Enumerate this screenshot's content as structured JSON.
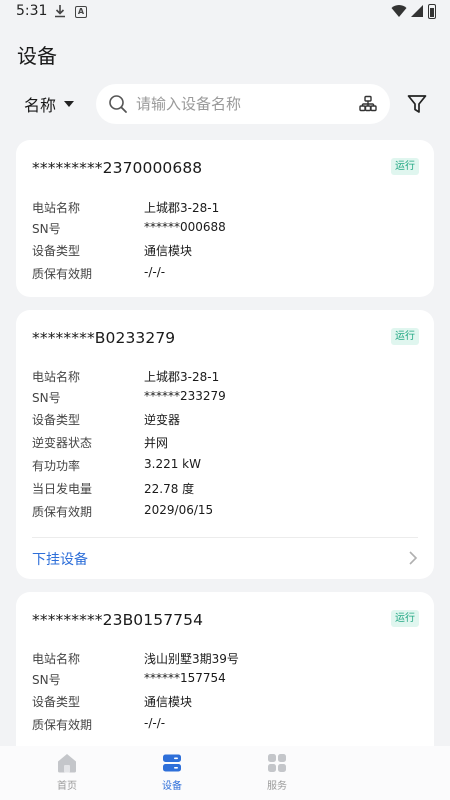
{
  "status_bar": {
    "time": "5:31",
    "icons": [
      "download-icon",
      "a-notification-icon",
      "wifi-icon",
      "signal-icon",
      "battery-icon"
    ]
  },
  "header": {
    "title": "设备"
  },
  "search": {
    "sort_label": "名称",
    "placeholder": "请输入设备名称"
  },
  "colors": {
    "accent": "#2e6fd9",
    "badge_bg": "#e0f6ef",
    "badge_text": "#21a783"
  },
  "devices": [
    {
      "id": "*********2370000688",
      "status": "运行",
      "fields": [
        {
          "label": "电站名称",
          "value": "上城郡3-28-1"
        },
        {
          "label": "SN号",
          "value": "******000688"
        },
        {
          "label": "设备类型",
          "value": "通信模块"
        },
        {
          "label": "质保有效期",
          "value": "-/-/-"
        }
      ]
    },
    {
      "id": "********B0233279",
      "status": "运行",
      "fields": [
        {
          "label": "电站名称",
          "value": "上城郡3-28-1"
        },
        {
          "label": "SN号",
          "value": "******233279"
        },
        {
          "label": "设备类型",
          "value": "逆变器"
        },
        {
          "label": "逆变器状态",
          "value": "并网"
        },
        {
          "label": "有功功率",
          "value": "3.221 kW"
        },
        {
          "label": "当日发电量",
          "value": "22.78 度"
        },
        {
          "label": "质保有效期",
          "value": "2029/06/15"
        }
      ],
      "sub_link": "下挂设备"
    },
    {
      "id": "*********23B0157754",
      "status": "运行",
      "fields": [
        {
          "label": "电站名称",
          "value": "浅山别墅3期39号"
        },
        {
          "label": "SN号",
          "value": "******157754"
        },
        {
          "label": "设备类型",
          "value": "通信模块"
        },
        {
          "label": "质保有效期",
          "value": "-/-/-"
        }
      ]
    }
  ],
  "bottom_nav": [
    {
      "label": "首页",
      "icon": "home-icon",
      "active": false
    },
    {
      "label": "设备",
      "icon": "device-icon",
      "active": true
    },
    {
      "label": "服务",
      "icon": "service-grid-icon",
      "active": false
    }
  ]
}
